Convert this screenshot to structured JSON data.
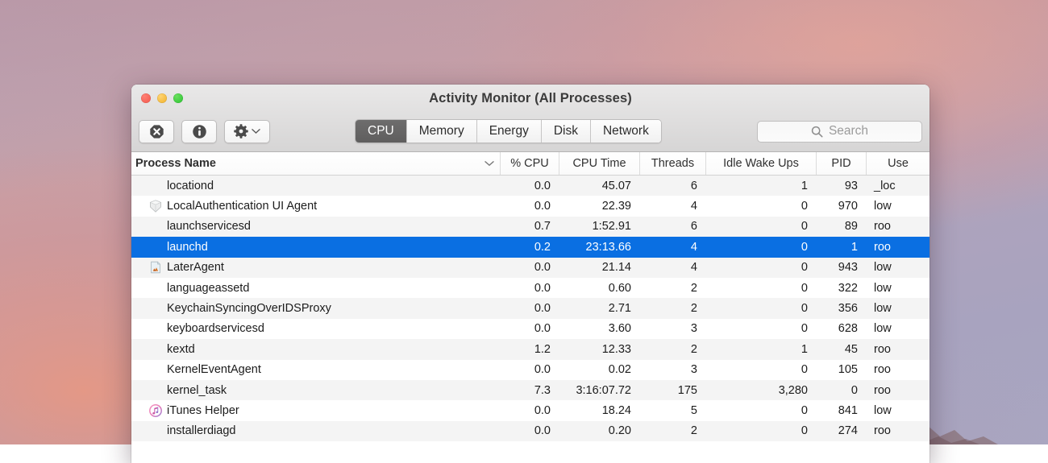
{
  "window": {
    "title": "Activity Monitor (All Processes)",
    "traffic_lights": [
      "close",
      "minimize",
      "zoom"
    ],
    "accent_selection": "#0a6fe2"
  },
  "toolbar": {
    "quit_process_label": "stop-process",
    "inspect_label": "inspect-process",
    "gear_label": "view-options",
    "tabs": [
      {
        "label": "CPU",
        "active": true
      },
      {
        "label": "Memory",
        "active": false
      },
      {
        "label": "Energy",
        "active": false
      },
      {
        "label": "Disk",
        "active": false
      },
      {
        "label": "Network",
        "active": false
      }
    ],
    "search": {
      "placeholder": "Search",
      "value": ""
    }
  },
  "table": {
    "columns": [
      {
        "key": "name",
        "label": "Process Name",
        "align": "left",
        "sorted": true
      },
      {
        "key": "cpu",
        "label": "% CPU",
        "align": "right"
      },
      {
        "key": "time",
        "label": "CPU Time",
        "align": "right"
      },
      {
        "key": "threads",
        "label": "Threads",
        "align": "right"
      },
      {
        "key": "idle",
        "label": "Idle Wake Ups",
        "align": "right"
      },
      {
        "key": "pid",
        "label": "PID",
        "align": "right"
      },
      {
        "key": "user",
        "label": "Use",
        "align": "left"
      }
    ],
    "rows": [
      {
        "name": "locationd",
        "icon": "none",
        "cpu": "0.0",
        "time": "45.07",
        "threads": "6",
        "idle": "1",
        "pid": "93",
        "user": "_loc",
        "selected": false
      },
      {
        "name": "LocalAuthentication UI Agent",
        "icon": "shield",
        "cpu": "0.0",
        "time": "22.39",
        "threads": "4",
        "idle": "0",
        "pid": "970",
        "user": "low",
        "selected": false
      },
      {
        "name": "launchservicesd",
        "icon": "none",
        "cpu": "0.7",
        "time": "1:52.91",
        "threads": "6",
        "idle": "0",
        "pid": "89",
        "user": "roo",
        "selected": false
      },
      {
        "name": "launchd",
        "icon": "none",
        "cpu": "0.2",
        "time": "23:13.66",
        "threads": "4",
        "idle": "0",
        "pid": "1",
        "user": "roo",
        "selected": true
      },
      {
        "name": "LaterAgent",
        "icon": "doc",
        "cpu": "0.0",
        "time": "21.14",
        "threads": "4",
        "idle": "0",
        "pid": "943",
        "user": "low",
        "selected": false
      },
      {
        "name": "languageassetd",
        "icon": "none",
        "cpu": "0.0",
        "time": "0.60",
        "threads": "2",
        "idle": "0",
        "pid": "322",
        "user": "low",
        "selected": false
      },
      {
        "name": "KeychainSyncingOverIDSProxy",
        "icon": "none",
        "cpu": "0.0",
        "time": "2.71",
        "threads": "2",
        "idle": "0",
        "pid": "356",
        "user": "low",
        "selected": false
      },
      {
        "name": "keyboardservicesd",
        "icon": "none",
        "cpu": "0.0",
        "time": "3.60",
        "threads": "3",
        "idle": "0",
        "pid": "628",
        "user": "low",
        "selected": false
      },
      {
        "name": "kextd",
        "icon": "none",
        "cpu": "1.2",
        "time": "12.33",
        "threads": "2",
        "idle": "1",
        "pid": "45",
        "user": "roo",
        "selected": false
      },
      {
        "name": "KernelEventAgent",
        "icon": "none",
        "cpu": "0.0",
        "time": "0.02",
        "threads": "3",
        "idle": "0",
        "pid": "105",
        "user": "roo",
        "selected": false
      },
      {
        "name": "kernel_task",
        "icon": "none",
        "cpu": "7.3",
        "time": "3:16:07.72",
        "threads": "175",
        "idle": "3,280",
        "pid": "0",
        "user": "roo",
        "selected": false
      },
      {
        "name": "iTunes Helper",
        "icon": "itunes",
        "cpu": "0.0",
        "time": "18.24",
        "threads": "5",
        "idle": "0",
        "pid": "841",
        "user": "low",
        "selected": false
      },
      {
        "name": "installerdiagd",
        "icon": "none",
        "cpu": "0.0",
        "time": "0.20",
        "threads": "2",
        "idle": "0",
        "pid": "274",
        "user": "roo",
        "selected": false
      }
    ]
  }
}
